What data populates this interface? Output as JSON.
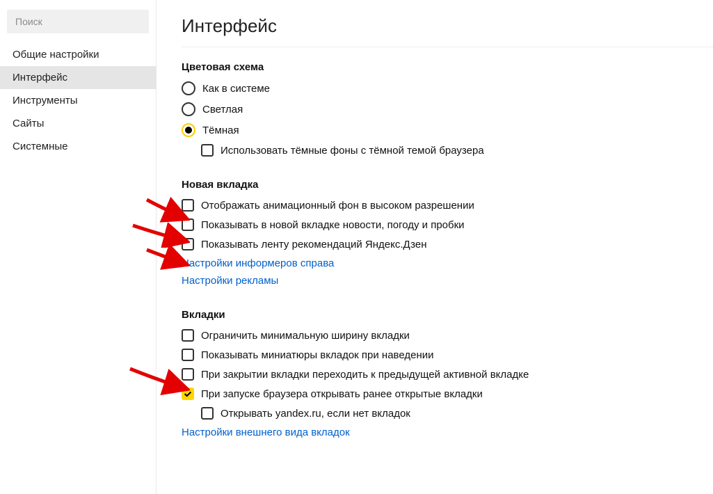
{
  "search": {
    "placeholder": "Поиск"
  },
  "sidebar": {
    "items": [
      {
        "label": "Общие настройки"
      },
      {
        "label": "Интерфейс"
      },
      {
        "label": "Инструменты"
      },
      {
        "label": "Сайты"
      },
      {
        "label": "Системные"
      }
    ]
  },
  "page": {
    "title": "Интерфейс"
  },
  "color_scheme": {
    "title": "Цветовая схема",
    "options": [
      {
        "label": "Как в системе"
      },
      {
        "label": "Светлая"
      },
      {
        "label": "Тёмная"
      }
    ],
    "dark_bg_checkbox": "Использовать тёмные фоны с тёмной темой браузера"
  },
  "new_tab": {
    "title": "Новая вкладка",
    "checkboxes": [
      {
        "label": "Отображать анимационный фон в высоком разрешении"
      },
      {
        "label": "Показывать в новой вкладке новости, погоду и пробки"
      },
      {
        "label": "Показывать ленту рекомендаций Яндекс.Дзен"
      }
    ],
    "links": [
      {
        "label": "Настройки информеров справа"
      },
      {
        "label": "Настройки рекламы"
      }
    ]
  },
  "tabs": {
    "title": "Вкладки",
    "checkboxes": [
      {
        "label": "Ограничить минимальную ширину вкладки"
      },
      {
        "label": "Показывать миниатюры вкладок при наведении"
      },
      {
        "label": "При закрытии вкладки переходить к предыдущей активной вкладке"
      },
      {
        "label": "При запуске браузера открывать ранее открытые вкладки"
      }
    ],
    "sub_checkbox": {
      "label": "Открывать yandex.ru, если нет вкладок"
    },
    "link": {
      "label": "Настройки внешнего вида вкладок"
    }
  }
}
